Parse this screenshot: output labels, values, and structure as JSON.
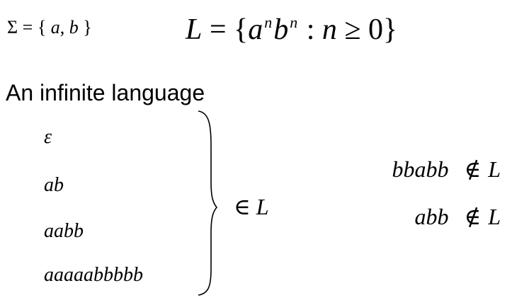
{
  "alphabet": {
    "symbol": "Σ",
    "equals": "=",
    "open": "{",
    "a": "a",
    "comma": ",",
    "b": "b",
    "close": "}"
  },
  "language": {
    "name": "L",
    "equals": "=",
    "open": "{",
    "base_a": "a",
    "exp_a": "n",
    "base_b": "b",
    "exp_b": "n",
    "colon": ":",
    "var": "n",
    "geq": "≥",
    "zero": "0",
    "close": "}"
  },
  "heading": "An infinite language",
  "members": [
    "ε",
    "ab",
    "aabb",
    "aaaaabbbbb"
  ],
  "membership": {
    "symbol": "∈",
    "set": "L"
  },
  "non_members": [
    {
      "word": "bbabb",
      "symbol": "∉",
      "set": "L"
    },
    {
      "word": "abb",
      "symbol": "∉",
      "set": "L"
    }
  ]
}
